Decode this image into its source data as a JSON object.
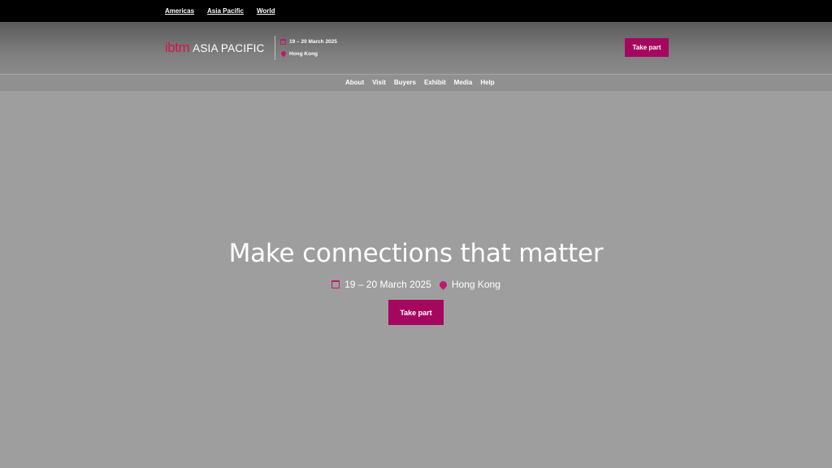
{
  "topbar": {
    "regions": [
      "Americas",
      "Asia Pacific",
      "World"
    ]
  },
  "header": {
    "logo_brand": "ibtm",
    "logo_region": "ASIA PACIFIC",
    "date": "19 – 20 March 2025",
    "location": "Hong Kong",
    "cta_label": "Take part"
  },
  "nav": {
    "items": [
      "About",
      "Visit",
      "Buyers",
      "Exhibit",
      "Media",
      "Help"
    ]
  },
  "hero": {
    "title": "Make connections that matter",
    "date": "19 – 20 March 2025",
    "location": "Hong Kong",
    "cta_label": "Take part"
  },
  "colors": {
    "accent": "#a5075f",
    "brand_red": "#d6164a",
    "topbar": "#000000"
  },
  "icons": [
    "calendar-icon",
    "map-pin-icon"
  ]
}
